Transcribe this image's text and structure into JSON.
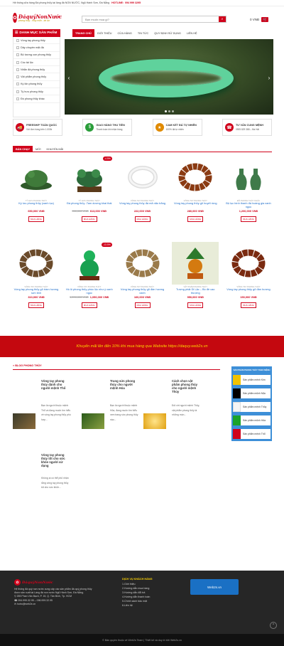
{
  "topbar": {
    "text": "Hệ thống cửa hàng Đá phong thủy tại làng đá NON NƯỚC, Ngũ Hành Sơn, Đà Nẵng",
    "hotline_label": "HOTLINE:",
    "hotline": "094 999 3295"
  },
  "logo": {
    "brand": "ĐáquýNonNước",
    "tagline": "phong thủy - may mắn - tài lộc"
  },
  "search": {
    "placeholder": "Bạn muốn mua gì?"
  },
  "cart": {
    "amount": "0 VNĐ"
  },
  "category": {
    "title": "DANH MỤC SẢN PHẨM",
    "items": [
      "Vòng tay phong thủy",
      "Dây chuyền mặt đá",
      "Bộ tượng con phong thủy",
      "Cóc tài lộc",
      "Nhẫn đá phong thủy",
      "Vật phẩm phong thủy",
      "Kỳ lân phong thủy",
      "Tỳ hưu phong thủy",
      "Đồ phong thủy khác"
    ]
  },
  "nav": [
    "TRANG CHỦ",
    "GIỚI THIỆU",
    "CỬA HÀNG",
    "TIN TỨC",
    "QUY ĐỊNH SỬ DỤNG",
    "LIÊN HỆ"
  ],
  "features": [
    {
      "title": "FREESHIP TOÀN QUỐC",
      "sub": "Với đơn hàng trên 1.000k",
      "icon": "truck-icon"
    },
    {
      "title": "GIAO HÀNG THU TIỀN",
      "sub": "Thanh toán khi nhận hàng",
      "icon": "cash-icon"
    },
    {
      "title": "CAM KẾT ĐÁ TỰ NHIÊN",
      "sub": "100% đá tự nhiên",
      "icon": "medal-icon"
    },
    {
      "title": "TƯ VẤN CUNG MỆNH",
      "sub": "0905 829 388 – Ms Hải",
      "icon": "phone-icon"
    }
  ],
  "tabs": [
    "BÁN CHẠY",
    "MỚI",
    "KHUYẾN MÃI"
  ],
  "products_row1": [
    {
      "cat": "TỲ HƯU PHONG THỦY",
      "name": "Kỳ lưu phong thủy (xanh lục)",
      "old": "",
      "price": "650,000 VNĐ",
      "sale": ""
    },
    {
      "cat": "TỲ HƯU PHONG THỦY",
      "name": "Đá phong thủy -Tam dương khai thái",
      "old": "950,000 VNĐ",
      "price": "613,000 VNĐ",
      "sale": "-4.5%"
    },
    {
      "cat": "VÒNG TAY PHONG THỦY",
      "name": "Vòng tay phong thủy đá mã não trắng",
      "old": "",
      "price": "222,000 VNĐ",
      "sale": ""
    },
    {
      "cat": "VÒNG TAY PHONG THỦY",
      "name": "Vòng tay phong thủy gỗ huyết rồng",
      "old": "",
      "price": "280,000 VNĐ",
      "sale": ""
    },
    {
      "cat": "ĐỒ PHONG THỦY KHÁC",
      "name": "Bộ lục bình thanh đá hoàng gia xanh ngọc",
      "old": "",
      "price": "1,200,000 VNĐ",
      "sale": ""
    }
  ],
  "products_row2": [
    {
      "cat": "VÒNG TAY PHONG THỦY",
      "name": "Vòng tay phong thủy gỗ trầm hương sơn tinh",
      "old": "",
      "price": "310,000 VNĐ",
      "sale": ""
    },
    {
      "cat": "VÒNG TAY PHONG THỦY",
      "name": "Hồ lô phong thủy-phúc lộc như ý xanh ngọc",
      "old": "1,200,000 VNĐ",
      "price": "1,050,000 VNĐ",
      "sale": "-13.5%"
    },
    {
      "cat": "VÒNG TAY PHONG THỦY",
      "name": "Vòng tay phong thủy gỗ đàn hương xanh",
      "old": "",
      "price": "160,000 VNĐ",
      "sale": ""
    },
    {
      "cat": "VẬT PHẨM PHONG THỦY",
      "name": "Tượng phật Di Lặc – Bồ đề cao thượng",
      "old": "",
      "price": "950,000 VNĐ",
      "sale": ""
    },
    {
      "cat": "VÒNG TAY PHONG THỦY",
      "name": "Vòng tay phong thủy gỗ đàn hương",
      "old": "",
      "price": "150,000 VNĐ",
      "sale": ""
    }
  ],
  "buy_label": "MUA HÀNG",
  "promo": "Khuyến mãi lên đến 10% khi mua hàng qua Website https://daquy.web2s.vn",
  "blog": {
    "title": "BLOG PHONG THỦY",
    "posts": [
      {
        "title": "Vòng tay phong thủy dành cho người mệnh Thổ",
        "excerpt": "Bạn là người thuộc mệnh Thổ và đang muốn tìm hiểu về vòng tay phong thủy phù hợp..."
      },
      {
        "title": "Trang sức phong thủy cho người mệnh Hỏa",
        "excerpt": "Bạn là người thuộc mệnh Hỏa, đang muốn tìm hiểu xem trang sức phong thủy nào..."
      },
      {
        "title": "Cách chọn vật phẩm phong thủy cho người mệnh Thủy",
        "excerpt": "Đối với người mệnh Thủy, vật phẩm phong thủy là những món..."
      },
      {
        "title": "Vòng tay phong thủy tốt cho sức khỏe người sử dụng",
        "excerpt": "Không ai có thể phủ nhận rằng vòng tay phong thủy tốt cho sức khỏe..."
      }
    ]
  },
  "menh": {
    "title": "SẢN PHẨM PHONG THỦY THEO MỆNH",
    "items": [
      {
        "label": "Sản phẩm mệnh Kim",
        "color": "#f2c200"
      },
      {
        "label": "Sản phẩm mệnh Mộc",
        "color": "#000000"
      },
      {
        "label": "Sản phẩm mệnh Thủy",
        "color": "#f5f5f5"
      },
      {
        "label": "Sản phẩm mệnh Hỏa",
        "color": "#1aa32a"
      },
      {
        "label": "Sản phẩm mệnh Thổ",
        "color": "#d0021b"
      }
    ]
  },
  "footer": {
    "about": "Hệ thống đá quý non nước cung cấp các sản phẩm đá quý phong thủy được sản xuất tại Làng đá non nước Ngũ Hành Sơn, Đà Nẵng.",
    "address": "285 Phan Văn Bạch, P. 15, Q. Tân Bình, Tp. HCM",
    "phone": "094.999.32.95 – 096.999.32.95",
    "email": "hotro@web2s.vn",
    "links_title": "DỊCH VỤ KHÁCH HÀNG",
    "links": [
      "1.Giới thiệu",
      "2.Hướng dẫn mua hàng",
      "3.Hướng dẫn đổi trả",
      "4.Hướng dẫn thanh toán",
      "5.Chính sách bảo mật",
      "6.Liên hệ"
    ],
    "badge": "Web2s.vn"
  },
  "copyright": "© Bản quyền thuộc về Web2s Team | Thiết kế và duy trì bởi Web2s.vn"
}
